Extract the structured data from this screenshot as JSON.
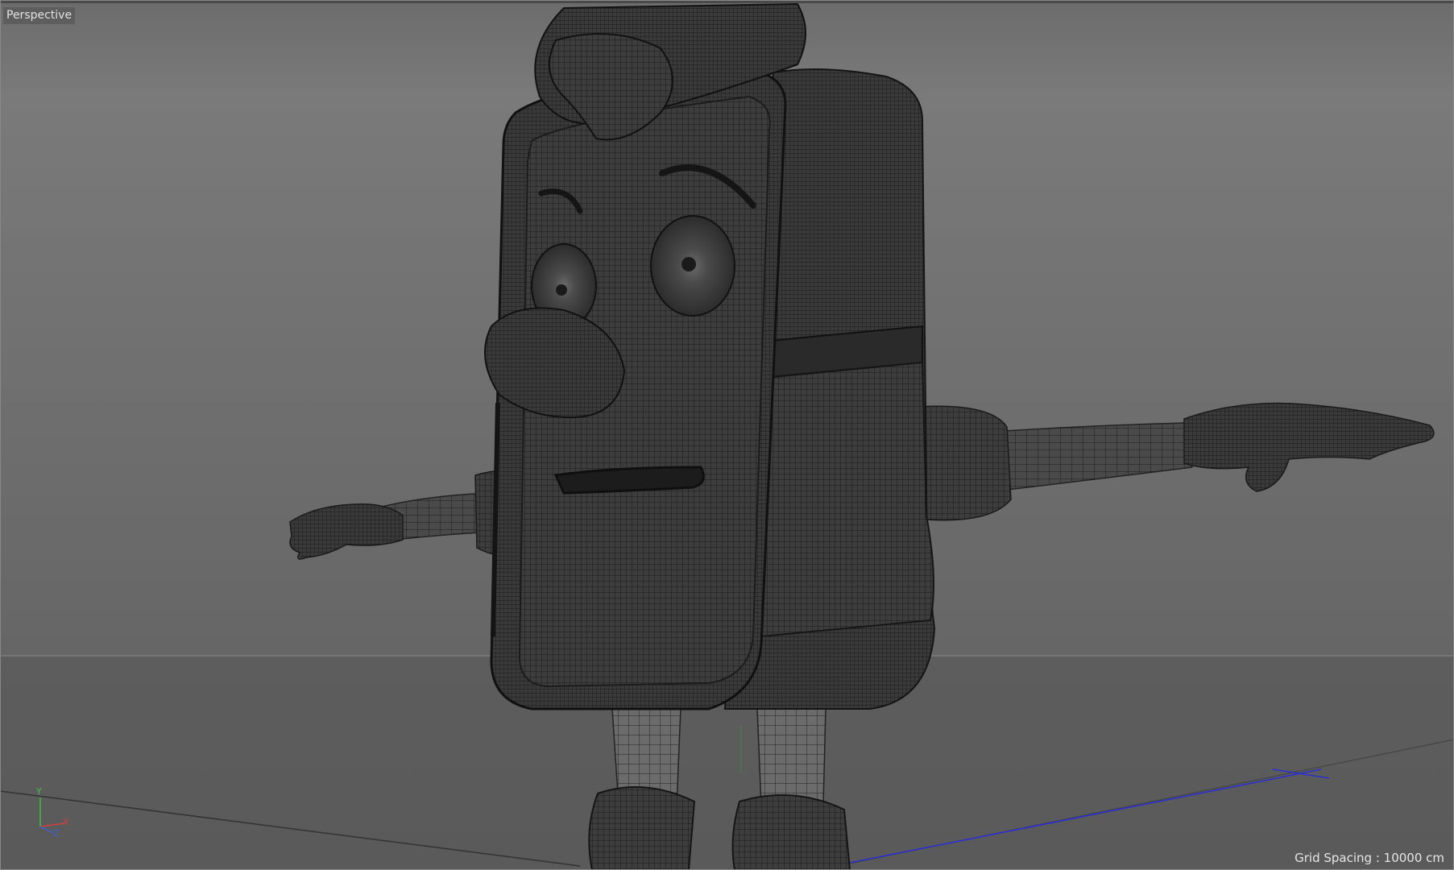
{
  "viewport": {
    "camera_label": "Perspective",
    "grid_spacing_label": "Grid Spacing : 10000 cm",
    "axes": {
      "y": "Y",
      "x": "X",
      "z": "Z"
    },
    "colors": {
      "background_top": "#7a7a7a",
      "background_bottom": "#5a5a5a",
      "mesh_fill": "#3e3e3e",
      "wire": "#1a1a1a",
      "axis_x": "#d04040",
      "axis_y": "#40c040",
      "axis_z": "#4060d0",
      "ground_line_blue": "#2b2fd0"
    }
  }
}
